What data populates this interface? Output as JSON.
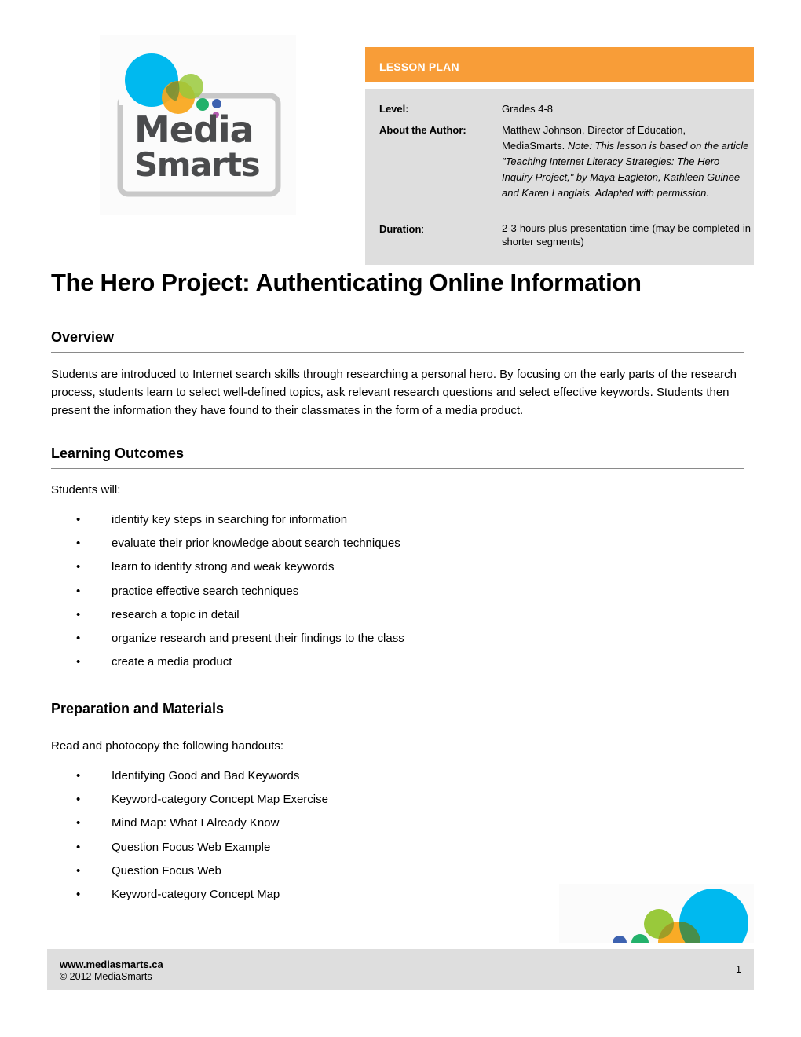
{
  "logo": {
    "line1": "Media",
    "line2": "Smarts",
    "colors": {
      "blue_circle": "#00b9ef",
      "orange_circle": "#f9a61a",
      "green_circle": "#99c93b",
      "teal_dot": "#23b16b",
      "navy_dot": "#3d62b0",
      "purple_dot": "#b45bb0",
      "text": "#4a4b4d",
      "frame": "#c8c8c8"
    }
  },
  "lesson_plan": {
    "header": "LESSON PLAN",
    "header_color": "#f89d38",
    "level": {
      "label": "Level:",
      "value": "Grades 4-8"
    },
    "author": {
      "label": "About the Author:",
      "value_plain": "Matthew Johnson, Director of Education, MediaSmarts.",
      "value_italic": "Note: This lesson is based on the article \"Teaching Internet Literacy Strategies: The Hero Inquiry Project,\" by Maya Eagleton, Kathleen Guinee and Karen Langlais. Adapted with permission."
    },
    "duration": {
      "label": "Duration",
      "label_suffix": ":",
      "value": "2-3 hours plus presentation time (may be completed in shorter segments)"
    }
  },
  "title": "The Hero Project: Authenticating Online Information",
  "overview": {
    "heading": "Overview",
    "text": "Students are introduced to Internet search skills through researching a personal hero. By focusing on the early parts of the research process, students learn to select well-defined topics, ask relevant research questions and select effective keywords. Students then present the information they have found to their classmates in the form of a media product."
  },
  "learning_outcomes": {
    "heading": "Learning Outcomes",
    "intro": "Students will:",
    "bullet": "•",
    "items": [
      "identify key steps in searching for information",
      "evaluate their prior knowledge about search techniques",
      "learn to identify strong and weak keywords",
      "practice effective search techniques",
      "research a topic in detail",
      "organize research and present their findings to the class",
      "create a media product"
    ]
  },
  "preparation": {
    "heading": "Preparation and Materials",
    "intro": "Read and photocopy the following handouts:",
    "bullet": "•",
    "items": [
      "Identifying Good and Bad Keywords",
      "Keyword-category Concept Map Exercise",
      "Mind Map: What I Already Know",
      "Question Focus Web Example",
      "Question Focus Web",
      "Keyword-category Concept Map"
    ]
  },
  "footer": {
    "url": "www.mediasmarts.ca",
    "copyright": "© 2012 MediaSmarts",
    "page_number": "1"
  }
}
